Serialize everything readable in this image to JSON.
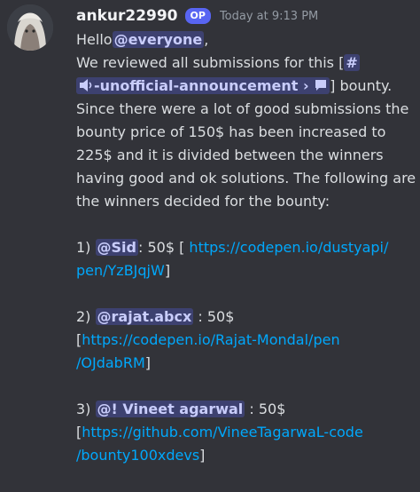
{
  "message": {
    "username": "ankur22990",
    "badge": "OP",
    "timestamp": "Today at 9:13 PM"
  },
  "content": {
    "greeting": "Hello",
    "everyone_mention": "@everyone",
    "greeting_suffix": ",",
    "l2_text": "We reviewed all submissions for this [",
    "channel_hash": "#",
    "channel_name": "-unofficial-announcement",
    "channel_chevron": "›",
    "l3_suffix": "] bounty.",
    "l4": "Since there were a lot of good submissions the",
    "l5": "bounty price of 150$ has been increased to",
    "l6": "225$ and it is divided between the winners",
    "l7": "having good and ok solutions. The following are",
    "l8": "the winners decided for the bounty:"
  },
  "winners": [
    {
      "number": "1)",
      "mention": "@Sid",
      "amount_text": ": 50$ [",
      "link_line1": "https://codepen.io/dustyapi/",
      "link_line2": "pen/YzBJqjW",
      "close": "]"
    },
    {
      "number": "2)",
      "mention": "@rajat.abcx",
      "amount_text": ": 50$",
      "open": "[",
      "link_line1": "https://codepen.io/Rajat-Mondal/pen",
      "link_line2": "/OJdabRM",
      "close": "]"
    },
    {
      "number": "3)",
      "mention": "@! Vineet agarwal",
      "amount_text": ": 50$",
      "open": "[",
      "link_line1": "https://github.com/VineeTagarwaL-code",
      "link_line2": "/bounty100xdevs",
      "close": "]"
    }
  ],
  "icons": {
    "avatar": "avatar",
    "speaker": "speaker-icon",
    "chat": "chat-bubble-icon"
  },
  "colors": {
    "background": "#323339",
    "mention_bg": "rgba(88,101,242,0.3)",
    "link": "#00a8fc",
    "badge": "#5865f2"
  }
}
